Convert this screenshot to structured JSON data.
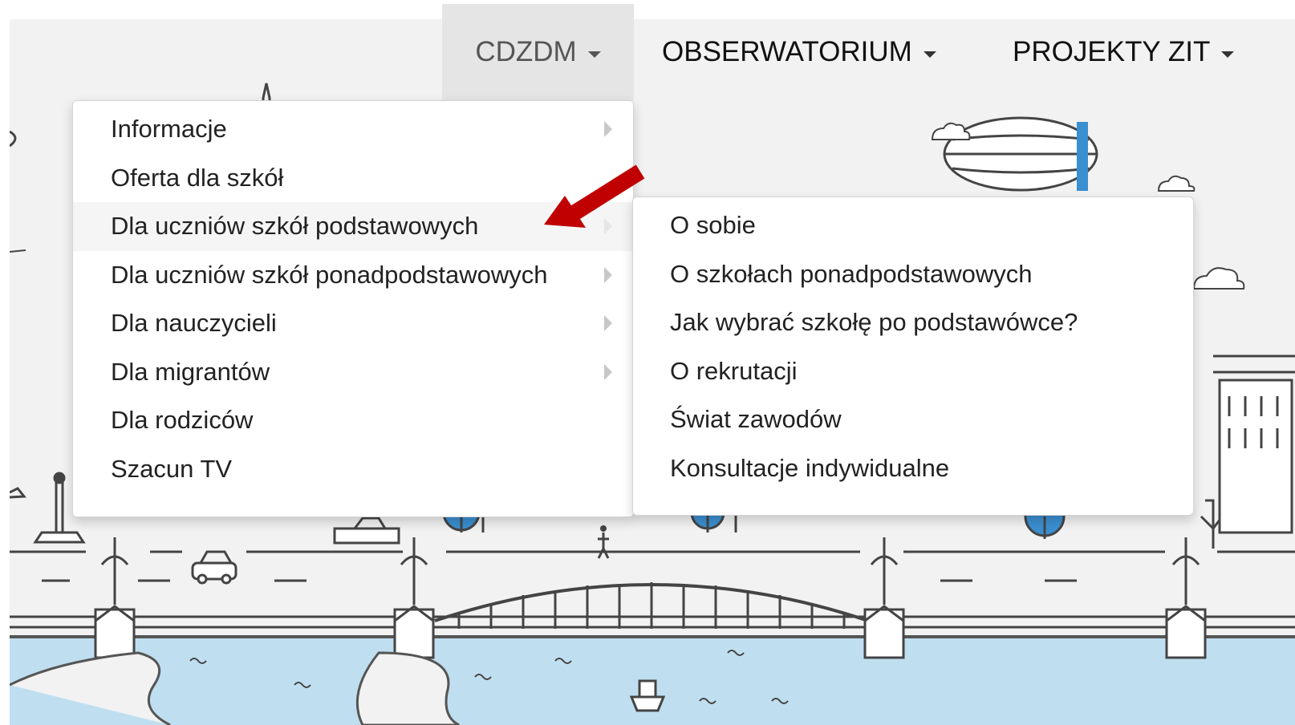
{
  "nav": {
    "items": [
      {
        "label": "CDZDM"
      },
      {
        "label": "OBSERWATORIUM"
      },
      {
        "label": "PROJEKTY ZIT"
      }
    ]
  },
  "menu": {
    "items": [
      {
        "label": "Informacje"
      },
      {
        "label": "Oferta dla szkół"
      },
      {
        "label": "Dla uczniów szkół podstawowych"
      },
      {
        "label": "Dla uczniów szkół ponadpodstawowych"
      },
      {
        "label": "Dla nauczycieli"
      },
      {
        "label": "Dla migrantów"
      },
      {
        "label": "Dla rodziców"
      },
      {
        "label": "Szacun TV"
      }
    ]
  },
  "submenu": {
    "items": [
      {
        "label": "O sobie"
      },
      {
        "label": "O szkołach ponadpodstawowych"
      },
      {
        "label": "Jak wybrać szkołę po podstawówce?"
      },
      {
        "label": "O rekrutacji"
      },
      {
        "label": "Świat zawodów"
      },
      {
        "label": "Konsultacje indywidualne"
      }
    ]
  },
  "colors": {
    "accent_red": "#c00000",
    "water": "#bfdff0",
    "tree_blue": "#3a8fd0",
    "nav_active_bg": "#e5e5e5"
  },
  "icons": [
    "caret-down-icon",
    "chevron-right-icon",
    "red-arrow-icon",
    "car-icon",
    "airship-icon",
    "cloud-icon",
    "boat-icon",
    "tree-icon",
    "lamp-icon",
    "bridge-icon"
  ]
}
